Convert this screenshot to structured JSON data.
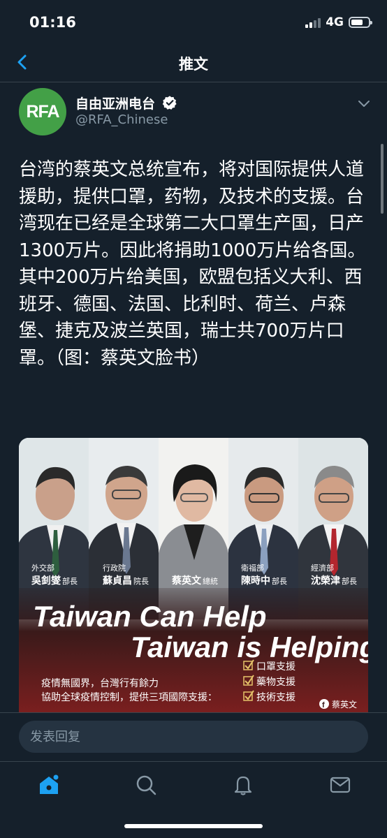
{
  "status_bar": {
    "time": "01:16",
    "network": "4G"
  },
  "nav": {
    "title": "推文"
  },
  "tweet": {
    "avatar_text": "RFA",
    "display_name": "自由亚洲电台",
    "handle": "@RFA_Chinese",
    "verified": true,
    "text": "台湾的蔡英文总统宣布，将对国际提供人道援助，提供口罩，药物，及技术的支援。台湾现在已经是全球第二大口罩生产国，日产1300万片。因此将捐助1000万片给各国。其中200万片给美国，欧盟包括义大利、西班牙、德国、法国、比利时、荷兰、卢森堡、捷克及波兰英国，瑞士共700万片口罩。（图：蔡英文脸书）"
  },
  "media": {
    "people": [
      {
        "dept": "外交部",
        "name": "吳釗燮",
        "title": "部長"
      },
      {
        "dept": "行政院",
        "name": "蘇貞昌",
        "title": "院長"
      },
      {
        "dept": "",
        "name": "蔡英文",
        "title": "總統"
      },
      {
        "dept": "衛福部",
        "name": "陳時中",
        "title": "部長"
      },
      {
        "dept": "經濟部",
        "name": "沈榮津",
        "title": "部長"
      }
    ],
    "headline_1": "Taiwan Can Help",
    "headline_2": "Taiwan is Helping",
    "caption_1": "疫情無國界，台灣行有餘力",
    "caption_2": "協助全球疫情控制，提供三項國際支援：",
    "checklist": [
      "口罩支援",
      "藥物支援",
      "技術支援"
    ],
    "credit": "蔡英文",
    "colors": {
      "banner_dark": "#3a1a1a",
      "banner_red": "#7a1f1f",
      "gold": "#e6c36a"
    }
  },
  "reply": {
    "placeholder": "发表回复"
  },
  "tab_bar": {
    "icons": [
      "home-icon",
      "search-icon",
      "bell-icon",
      "mail-icon"
    ]
  },
  "colors": {
    "background": "#15202b",
    "accent": "#1da1f2",
    "secondary_text": "#8899a6",
    "verified_badge": "#ffffff",
    "avatar_bg": "#43a047"
  }
}
